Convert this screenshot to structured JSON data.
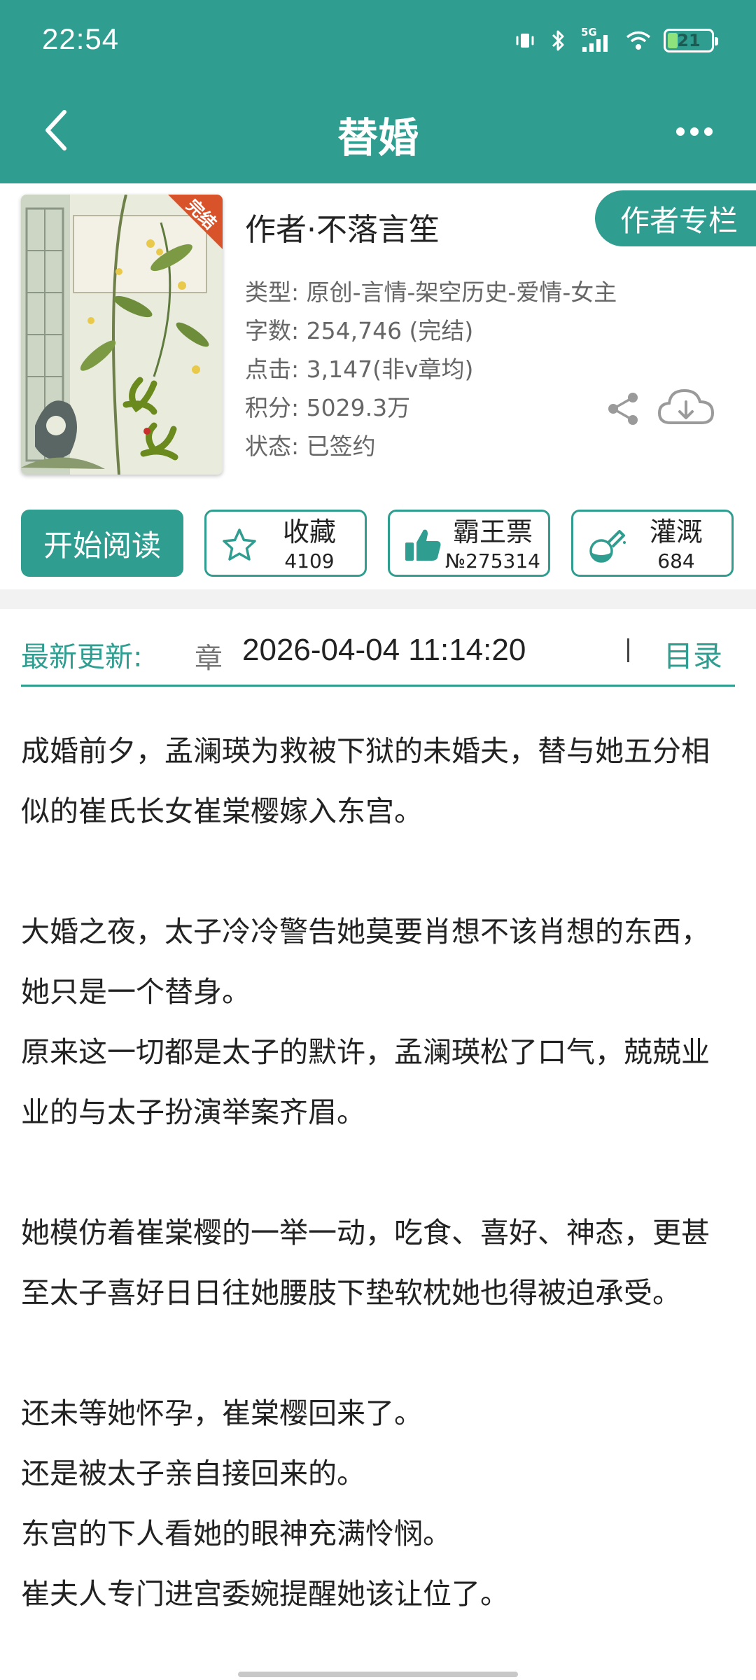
{
  "status_bar": {
    "time": "22:54",
    "network": "5G",
    "battery": "21"
  },
  "nav": {
    "title": "替婚"
  },
  "book": {
    "cover_badge": "完结",
    "cover_title": "替婚",
    "author": "作者·不落言笙",
    "author_column": "作者专栏",
    "meta": {
      "type": "类型: 原创-言情-架空历史-爱情-女主",
      "words": "字数: 254,746 (完结)",
      "clicks": "点击: 3,147(非v章均)",
      "score": "积分: 5029.3万",
      "status": "状态: 已签约"
    }
  },
  "actions": {
    "start_reading": "开始阅读",
    "favorite": {
      "label": "收藏",
      "value": "4109",
      "icon": "star-icon"
    },
    "vote": {
      "label": "霸王票",
      "value": "№275314",
      "icon": "thumbs-up-icon"
    },
    "nutrient": {
      "label": "灌溉",
      "value": "684",
      "icon": "watering-bottle-icon"
    }
  },
  "update": {
    "label": "最新更新:",
    "chapter": "章",
    "time": "2026-04-04 11:14:20",
    "toc": "目录"
  },
  "intro": [
    "成婚前夕，孟澜瑛为救被下狱的未婚夫，替与她五分相似的崔氏长女崔棠樱嫁入东宫。",
    "",
    "大婚之夜，太子冷冷警告她莫要肖想不该肖想的东西，她只是一个替身。",
    "原来这一切都是太子的默许，孟澜瑛松了口气，兢兢业业的与太子扮演举案齐眉。",
    "",
    "她模仿着崔棠樱的一举一动，吃食、喜好、神态，更甚至太子喜好日日往她腰肢下垫软枕她也得被迫承受。",
    "",
    "还未等她怀孕，崔棠樱回来了。",
    "还是被太子亲自接回来的。",
    "东宫的下人看她的眼神充满怜悯。",
    "崔夫人专门进宫委婉提醒她该让位了。"
  ],
  "colors": {
    "accent": "#2f9d8f",
    "text": "#222222",
    "meta_text": "#666666"
  }
}
